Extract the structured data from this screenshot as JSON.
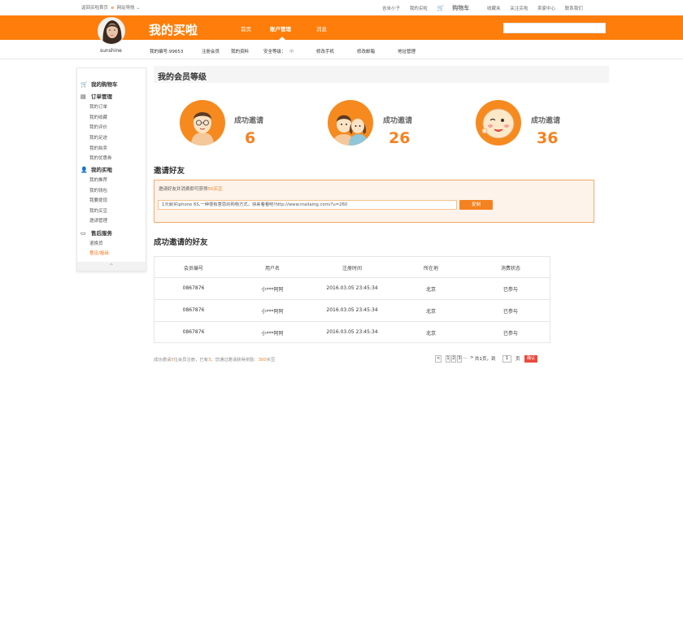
{
  "topbar": {
    "home_link": "返回买啦首页",
    "site_nav": "网站导航",
    "user_greeting": "吉米小子",
    "my_account": "我的买啦",
    "cart": "购物车",
    "favorites": "收藏夹",
    "follow": "关注买啦",
    "seller_center": "卖家中心",
    "contact": "联系我们"
  },
  "header": {
    "logo_text": "我的买啦",
    "nav": [
      "首页",
      "账户管理",
      "消息"
    ],
    "active_nav": "账户管理",
    "search_placeholder": ""
  },
  "subbar": {
    "username": "sunshine",
    "member_id": "我的编号:99653",
    "items": [
      "注册会员",
      "我的资料",
      "安全等级：",
      "中",
      "修改手机",
      "修改邮箱",
      "地址管理"
    ]
  },
  "sidebar": {
    "sections": [
      {
        "title": "我的购物车",
        "icon": "cart-icon",
        "items": []
      },
      {
        "title": "订单管理",
        "icon": "document-icon",
        "items": [
          "我的订单",
          "我的收藏",
          "我的评价",
          "我的足迹",
          "我的拍卖",
          "我的优惠券"
        ]
      },
      {
        "title": "我的买啦",
        "icon": "person-icon",
        "items": [
          "我的推荐",
          "我的钱包",
          "我要提现",
          "我的买豆",
          "邀请管理"
        ]
      },
      {
        "title": "售后服务",
        "icon": "card-icon",
        "items": [
          "退换货",
          "意见/投诉"
        ]
      }
    ],
    "active_item": "意见/投诉",
    "collapse": "^"
  },
  "main": {
    "title": "我的会员等级",
    "levels": [
      {
        "label": "成功邀请",
        "count": "6",
        "icon": "man-glasses-avatar-icon"
      },
      {
        "label": "成功邀请",
        "count": "26",
        "icon": "couple-avatar-icon"
      },
      {
        "label": "成功邀请",
        "count": "36",
        "icon": "smiley-face-icon"
      }
    ],
    "invite": {
      "heading": "邀请好友",
      "text_prefix": "邀请好友并消费即可获得",
      "text_highlight": "50买豆",
      "link_value": "1元就买iphone 6S,一种很有意思的购物方式，快来看看吧!http://www.mailaing.com/?u=260",
      "copy_button": "复制"
    },
    "friends": {
      "heading": "成功邀请的好友",
      "columns": [
        "会员编号",
        "用户名",
        "注册时间",
        "所在地",
        "消费状态"
      ],
      "rows": [
        [
          "0867876",
          "小***阿阿",
          "2016.03.05 23:45:34",
          "北京",
          "已参与"
        ],
        [
          "0867876",
          "小***阿阿",
          "2016.03.05 23:45:34",
          "北京",
          "已参与"
        ],
        [
          "0867876",
          "小***阿阿",
          "2016.03.05 23:45:34",
          "北京",
          "已参与"
        ]
      ]
    },
    "footer_note": {
      "p1": "成功邀请",
      "n1": "5",
      "p2": "位会员注册，已有",
      "n2": "3",
      "p3": "，您通过邀请获得奖励：",
      "n3": "300",
      "p4": "买豆"
    },
    "pager": {
      "prev": "<",
      "pages": [
        "1",
        "2",
        "3"
      ],
      "ellipsis": "...",
      "next": ">",
      "total": "共1页，到",
      "page_input": "1",
      "page_unit": "页",
      "go": "确认"
    }
  }
}
